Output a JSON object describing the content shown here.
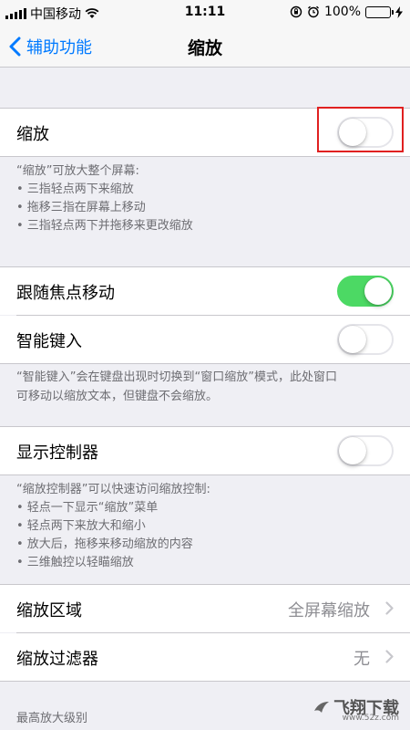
{
  "status_bar": {
    "carrier": "中国移动",
    "time": "11:11",
    "battery": "100%"
  },
  "nav": {
    "back_label": "辅助功能",
    "title": "缩放"
  },
  "zoom": {
    "label": "缩放",
    "toggle_on": false
  },
  "zoom_footer": {
    "intro": "“缩放”可放大整个屏幕:",
    "items": [
      "• 三指轻点两下来缩放",
      "• 拖移三指在屏幕上移动",
      "• 三指轻点两下并拖移来更改缩放"
    ]
  },
  "follow_focus": {
    "label": "跟随焦点移动",
    "toggle_on": true
  },
  "smart_typing": {
    "label": "智能键入",
    "toggle_on": false
  },
  "smart_typing_footer": {
    "line1": "“智能键入”会在键盘出现时切换到“窗口缩放”模式，此处窗口",
    "line2": "可移动以缩放文本，但键盘不会缩放。"
  },
  "show_controller": {
    "label": "显示控制器",
    "toggle_on": false
  },
  "controller_footer": {
    "intro": "“缩放控制器”可以快速访问缩放控制:",
    "items": [
      "• 轻点一下显示“缩放”菜单",
      "• 轻点两下来放大和缩小",
      "• 放大后，拖移来移动缩放的内容",
      "• 三维触控以轻瞄缩放"
    ]
  },
  "zoom_region": {
    "label": "缩放区域",
    "value": "全屏幕缩放"
  },
  "zoom_filter": {
    "label": "缩放过滤器",
    "value": "无"
  },
  "max_zoom_header": "最高放大级别",
  "watermark": {
    "text": "飞翔下载",
    "sub": "www.52z.com"
  },
  "colors": {
    "accent": "#007aff",
    "toggle_on": "#4cd964",
    "highlight": "#e02020"
  }
}
